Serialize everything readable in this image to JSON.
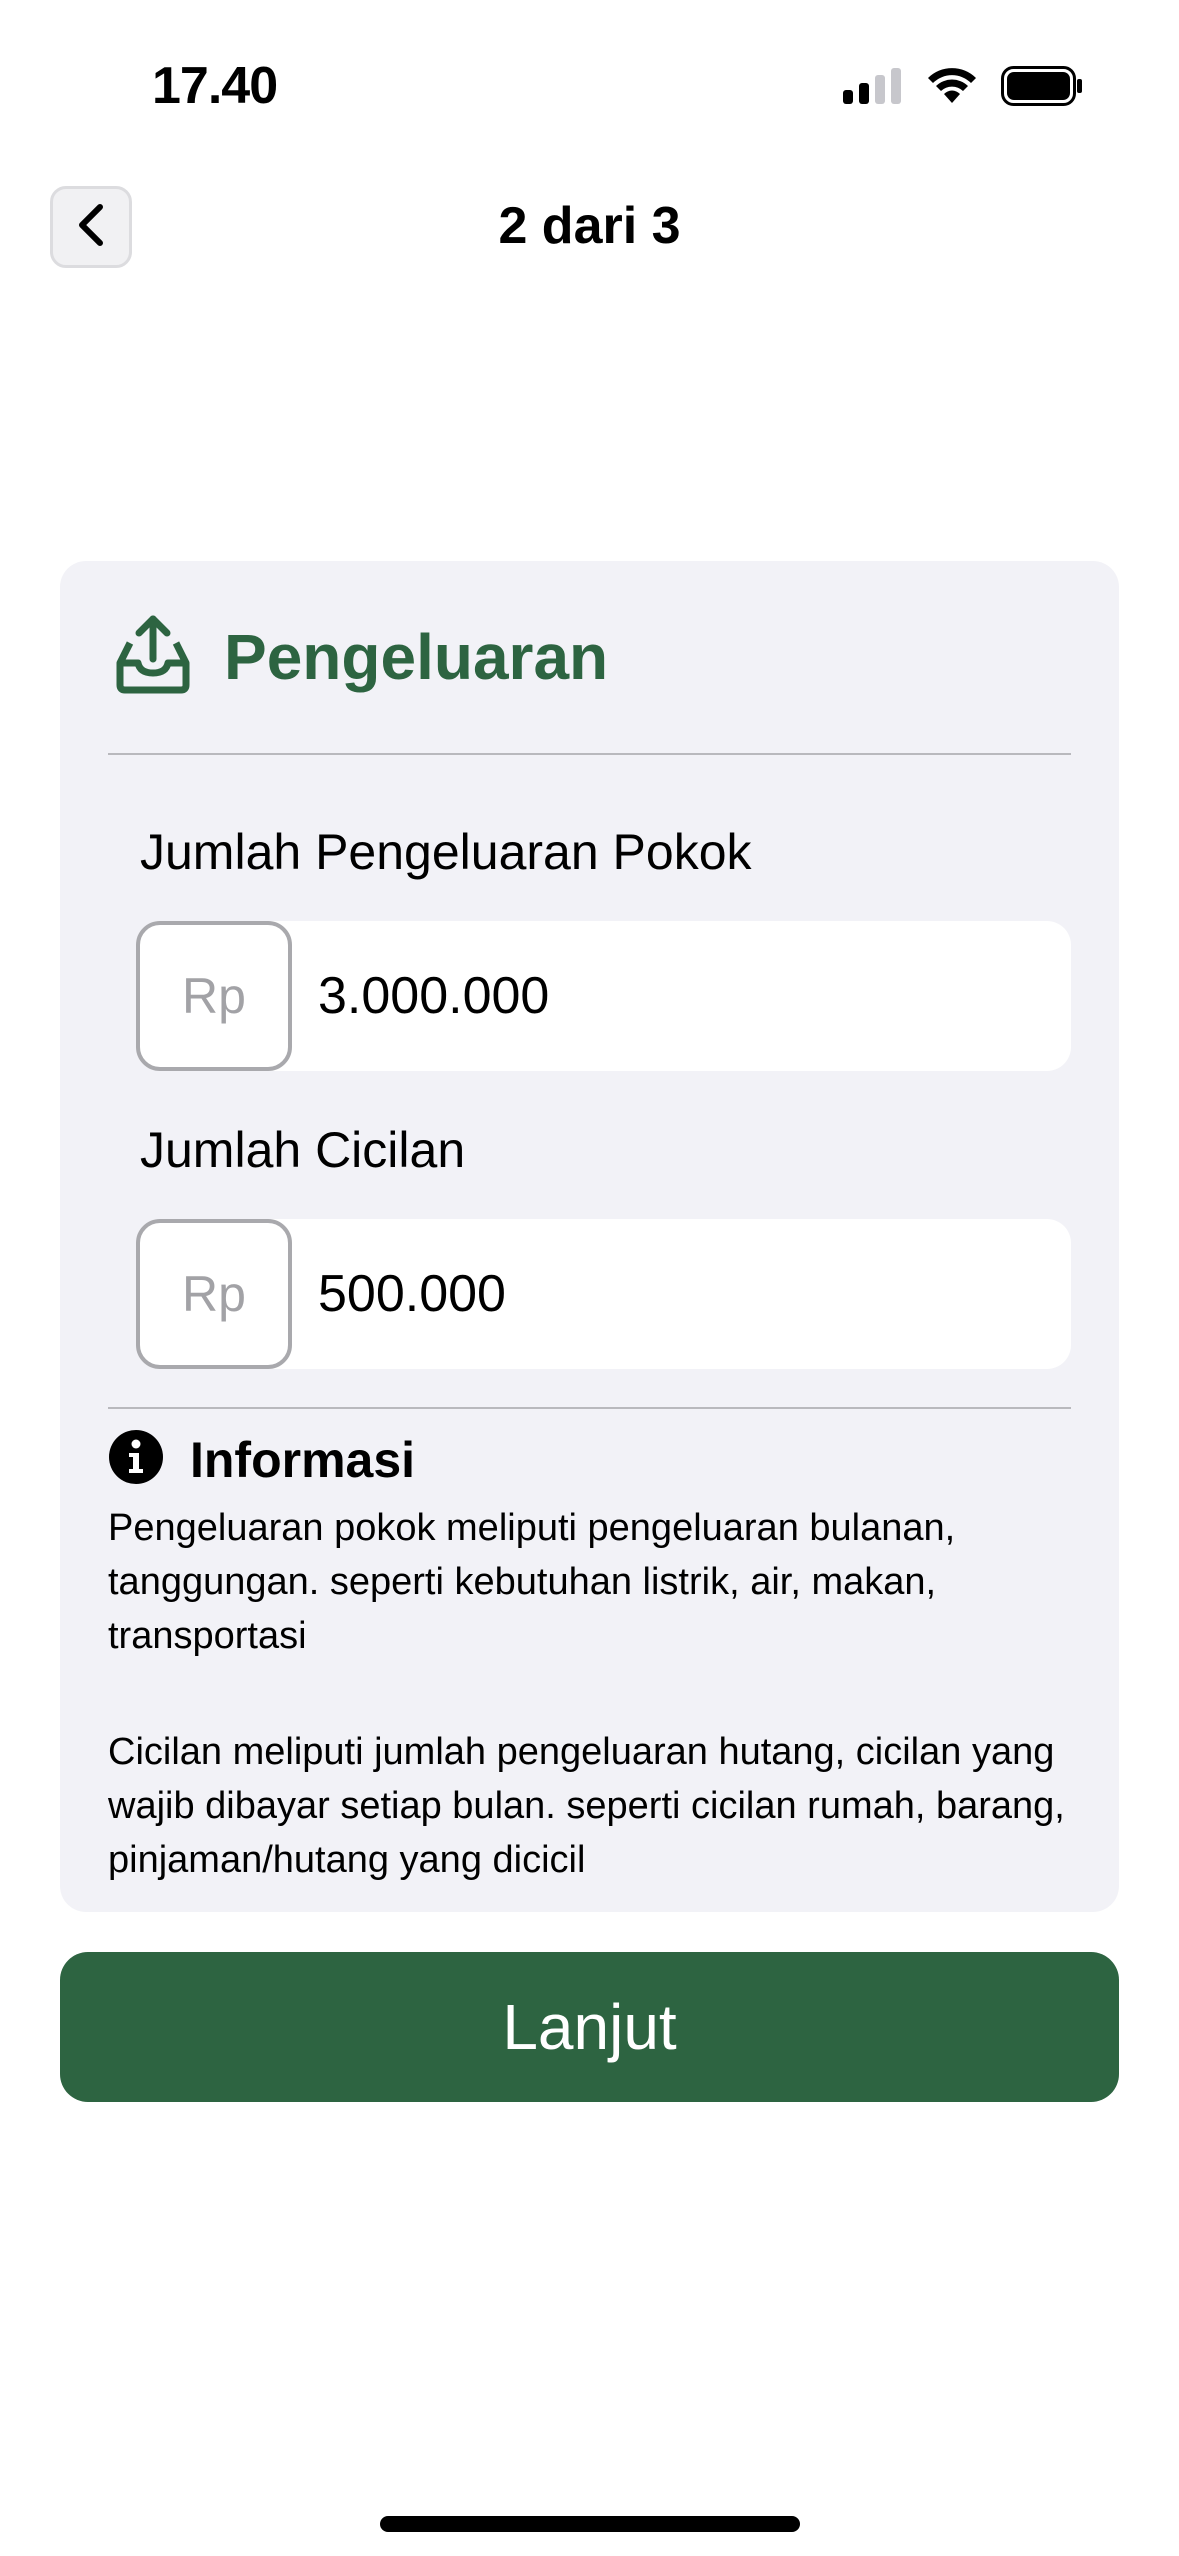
{
  "status_bar": {
    "time": "17.40",
    "icons": [
      "cellular-signal-icon",
      "wifi-icon",
      "battery-icon"
    ]
  },
  "nav": {
    "back_icon": "chevron-left-icon",
    "title": "2 dari 3"
  },
  "card": {
    "icon": "tray-upload-icon",
    "title": "Pengeluaran",
    "fields": [
      {
        "label": "Jumlah Pengeluaran Pokok",
        "prefix": "Rp",
        "value": "3.000.000"
      },
      {
        "label": "Jumlah Cicilan",
        "prefix": "Rp",
        "value": "500.000"
      }
    ],
    "info": {
      "icon": "info-circle-icon",
      "title": "Informasi",
      "paragraphs": [
        "Pengeluaran pokok meliputi pengeluaran bulanan, tanggungan. seperti kebutuhan listrik, air, makan, transportasi",
        "Cicilan meliputi jumlah pengeluaran hutang, cicilan yang wajib dibayar setiap bulan. seperti cicilan rumah, barang, pinjaman/hutang yang dicicil"
      ]
    }
  },
  "primary_button": {
    "label": "Lanjut"
  },
  "colors": {
    "accent": "#2d6441",
    "card_background": "#f2f2f7",
    "placeholder": "#a2a2a6"
  }
}
